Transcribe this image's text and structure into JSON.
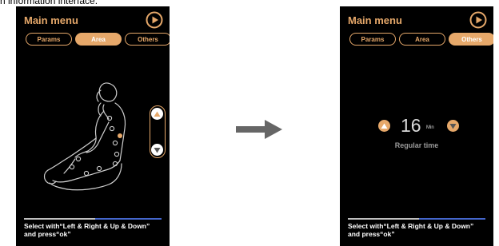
{
  "caption": "n information interface.",
  "colors": {
    "accent": "#e6a86a",
    "screen_background": "#000000",
    "chair_outline": "#cfcfcf",
    "arrow": "#666666"
  },
  "left_screen": {
    "title": "Main menu",
    "play_icon": "play-circle-icon",
    "tabs": [
      {
        "label": "Params",
        "active": false
      },
      {
        "label": "Area",
        "active": true
      },
      {
        "label": "Others",
        "active": false
      }
    ],
    "chair_icon": "massage-chair-icon",
    "adjust_up_icon": "triangle-up-icon",
    "adjust_down_icon": "triangle-down-icon",
    "progress": {
      "filled": 0.52
    },
    "hint_line1": "Select with“Left & Right & Up & Down”",
    "hint_line2": "and press“ok”"
  },
  "right_screen": {
    "title": "Main menu",
    "play_icon": "play-circle-icon",
    "tabs": [
      {
        "label": "Params",
        "active": false
      },
      {
        "label": "Area",
        "active": false
      },
      {
        "label": "Others",
        "active": true
      }
    ],
    "time_value": "16",
    "time_unit": "Min",
    "time_label": "Regular time",
    "progress": {
      "filled": 0.52
    },
    "hint_line1": "Select with“Left & Right & Up & Down”",
    "hint_line2": "and press“ok”"
  },
  "transition_arrow_icon": "arrow-right-icon"
}
